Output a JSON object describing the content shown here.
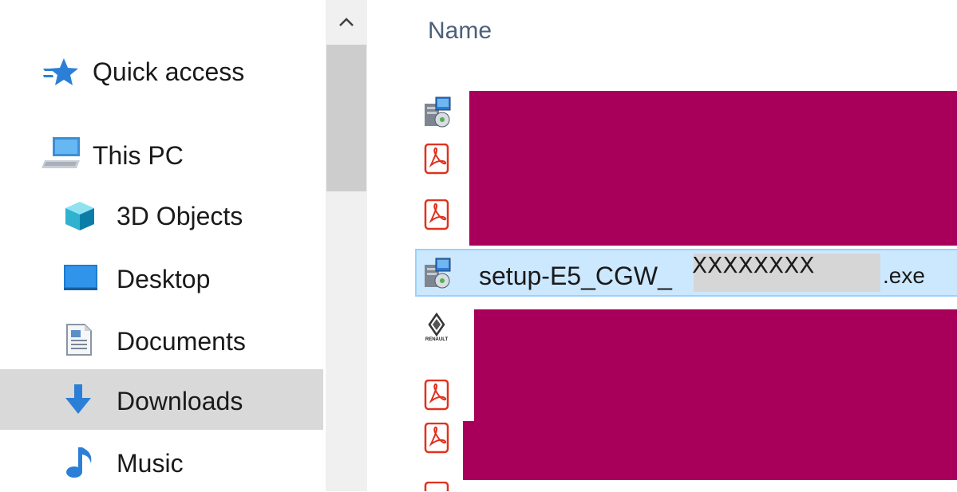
{
  "navigation": {
    "items": [
      {
        "label": "Quick access",
        "icon": "quick-access-star-icon"
      },
      {
        "label": "This PC",
        "icon": "computer-icon"
      },
      {
        "label": "3D Objects",
        "icon": "3d-objects-cube-icon"
      },
      {
        "label": "Desktop",
        "icon": "desktop-icon"
      },
      {
        "label": "Documents",
        "icon": "documents-icon"
      },
      {
        "label": "Downloads",
        "icon": "downloads-arrow-icon",
        "selected": true
      },
      {
        "label": "Music",
        "icon": "music-note-icon"
      }
    ]
  },
  "filelist": {
    "column_name": "Name",
    "selected_file": {
      "name_prefix": "setup-E5_CGW_",
      "name_overlay": "XXXXXXXX",
      "extension": ".exe"
    },
    "rows": [
      {
        "icon": "installer-icon",
        "redacted": true
      },
      {
        "icon": "pdf-icon",
        "redacted": true
      },
      {
        "icon": "pdf-icon",
        "redacted": true
      },
      {
        "icon": "installer-icon",
        "selected": true
      },
      {
        "icon": "renault-logo-icon",
        "redacted": true,
        "icon_caption": "RENAULT"
      },
      {
        "icon": "pdf-icon",
        "redacted": true
      },
      {
        "icon": "pdf-icon",
        "redacted": true
      },
      {
        "icon": "pdf-icon",
        "redacted": false
      }
    ]
  },
  "colors": {
    "selection_background": "#cce8ff",
    "selection_border": "#99d1ff",
    "nav_selected_background": "#d9d9d9",
    "redaction": "#a8005a",
    "pdf_icon_red": "#e0321e"
  }
}
